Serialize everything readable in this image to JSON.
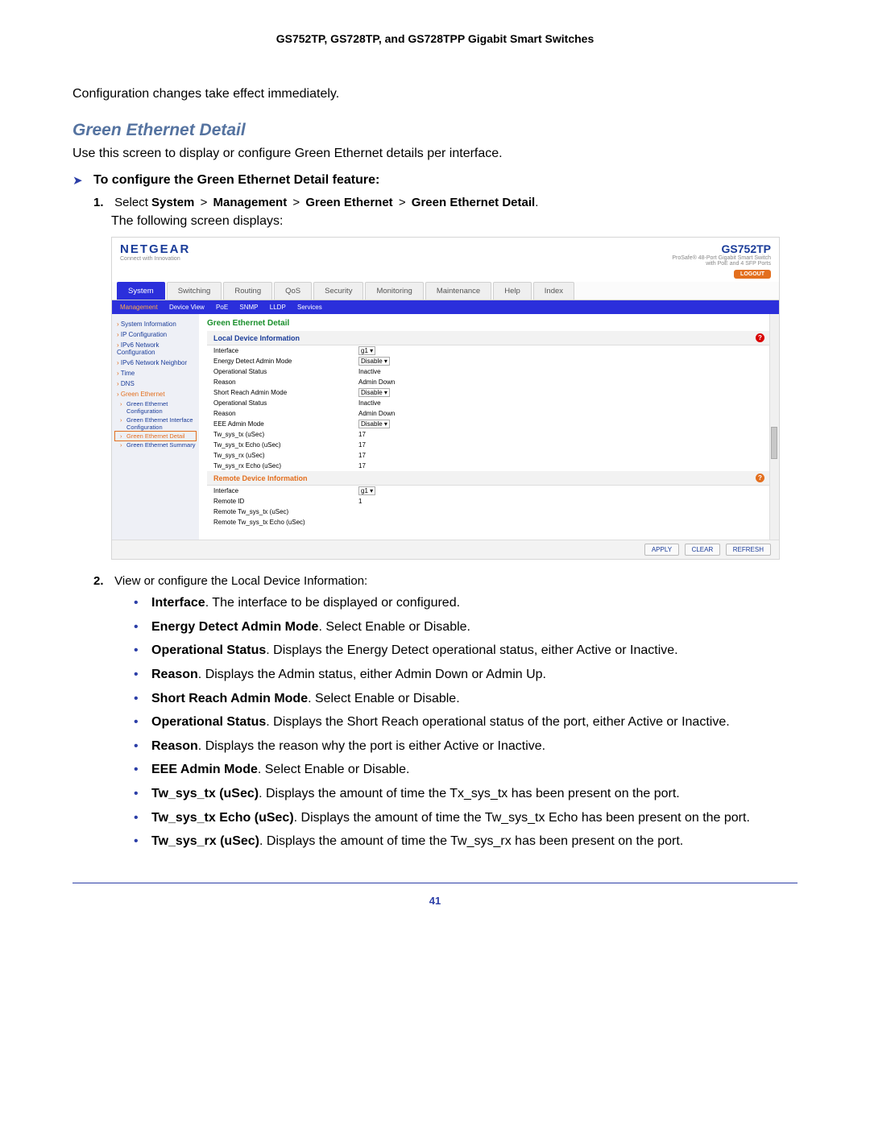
{
  "header": {
    "title": "GS752TP, GS728TP, and GS728TPP Gigabit Smart Switches"
  },
  "intro": {
    "line1": "Configuration changes take effect immediately."
  },
  "section": {
    "heading": "Green Ethernet Detail",
    "desc": "Use this screen to display or configure Green Ethernet details per interface.",
    "to_configure": "To configure the Green Ethernet Detail feature:"
  },
  "steps": {
    "s1_prefix": "Select ",
    "s1_b1": "System",
    "s1_b2": "Management",
    "s1_b3": "Green Ethernet",
    "s1_b4": "Green Ethernet Detail",
    "s1_after": "The following screen displays:",
    "s2": "View or configure the Local Device Information:"
  },
  "screenshot": {
    "logo": "NETGEAR",
    "logo_sub": "Connect with Innovation",
    "model": "GS752TP",
    "model_sub1": "ProSafe® 48-Port Gigabit Smart Switch",
    "model_sub2": "with PoE and 4 SFP Ports",
    "logout": "LOGOUT",
    "tabs": [
      "System",
      "Switching",
      "Routing",
      "QoS",
      "Security",
      "Monitoring",
      "Maintenance",
      "Help",
      "Index"
    ],
    "subtabs": [
      "Management",
      "Device View",
      "PoE",
      "SNMP",
      "LLDP",
      "Services"
    ],
    "sidebar": {
      "items": [
        "System Information",
        "IP Configuration",
        "IPv6 Network Configuration",
        "IPv6 Network Neighbor",
        "Time",
        "DNS",
        "Green Ethernet"
      ],
      "sub": [
        "Green Ethernet Configuration",
        "Green Ethernet Interface Configuration",
        "Green Ethernet Detail",
        "Green Ethernet Summary"
      ]
    },
    "panel": {
      "title": "Green Ethernet Detail",
      "local_title": "Local Device Information",
      "remote_title": "Remote Device Information",
      "rows_local": [
        {
          "label": "Interface",
          "value": "g1",
          "type": "select"
        },
        {
          "label": "Energy Detect Admin Mode",
          "value": "Disable",
          "type": "select"
        },
        {
          "label": "Operational Status",
          "value": "Inactive"
        },
        {
          "label": "Reason",
          "value": "Admin Down"
        },
        {
          "label": "Short Reach Admin Mode",
          "value": "Disable",
          "type": "select"
        },
        {
          "label": "Operational Status",
          "value": "Inactive"
        },
        {
          "label": "Reason",
          "value": "Admin Down"
        },
        {
          "label": "EEE Admin Mode",
          "value": "Disable",
          "type": "select"
        },
        {
          "label": "Tw_sys_tx (uSec)",
          "value": "17"
        },
        {
          "label": "Tw_sys_tx Echo (uSec)",
          "value": "17"
        },
        {
          "label": "Tw_sys_rx (uSec)",
          "value": "17"
        },
        {
          "label": "Tw_sys_rx Echo (uSec)",
          "value": "17"
        }
      ],
      "rows_remote": [
        {
          "label": "Interface",
          "value": "g1",
          "type": "select"
        },
        {
          "label": "Remote ID",
          "value": "1"
        },
        {
          "label": "Remote Tw_sys_tx (uSec)",
          "value": ""
        },
        {
          "label": "Remote Tw_sys_tx Echo (uSec)",
          "value": ""
        }
      ]
    },
    "buttons": {
      "apply": "APPLY",
      "clear": "CLEAR",
      "refresh": "REFRESH"
    }
  },
  "bullets": [
    {
      "b": "Interface",
      "t": ". The interface to be displayed or configured."
    },
    {
      "b": "Energy Detect Admin Mode",
      "t": ". Select Enable or Disable."
    },
    {
      "b": "Operational Status",
      "t": ". Displays the Energy Detect operational status, either Active or Inactive."
    },
    {
      "b": "Reason",
      "t": ". Displays the Admin status, either Admin Down or Admin Up."
    },
    {
      "b": "Short Reach Admin Mode",
      "t": ". Select Enable or Disable."
    },
    {
      "b": "Operational Status",
      "t": ". Displays the Short Reach operational status of the port, either Active or Inactive."
    },
    {
      "b": "Reason",
      "t": ". Displays the reason why the port is either Active or Inactive."
    },
    {
      "b": "EEE Admin Mode",
      "t": ". Select Enable or Disable."
    },
    {
      "b": "Tw_sys_tx (uSec)",
      "t": ". Displays the amount of time the Tx_sys_tx has been present on the port."
    },
    {
      "b": "Tw_sys_tx Echo (uSec)",
      "t": ". Displays the amount of time the Tw_sys_tx Echo has been present on the port."
    },
    {
      "b": "Tw_sys_rx (uSec)",
      "t": ". Displays the amount of time the Tw_sys_rx has been present on the port."
    }
  ],
  "footer": {
    "page": "41"
  }
}
